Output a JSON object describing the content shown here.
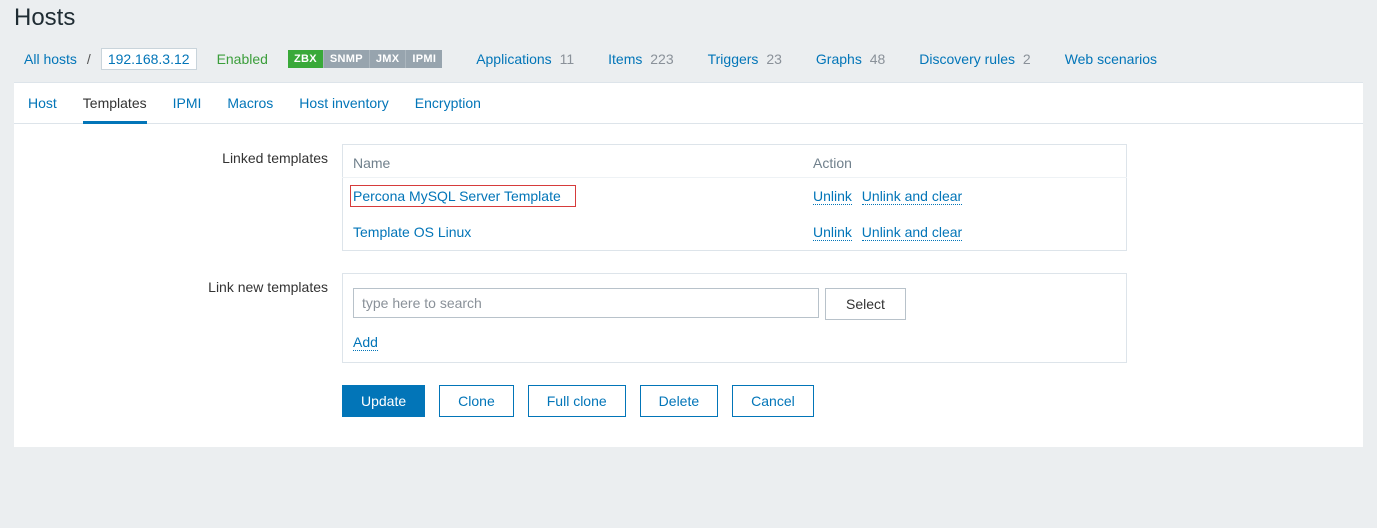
{
  "page": {
    "title": "Hosts"
  },
  "breadcrumb": {
    "all_hosts": "All hosts",
    "sep": "/",
    "host_ip": "192.168.3.12",
    "status": "Enabled",
    "protocols": [
      {
        "code": "ZBX",
        "kind": "zbx"
      },
      {
        "code": "SNMP",
        "kind": "gray"
      },
      {
        "code": "JMX",
        "kind": "gray"
      },
      {
        "code": "IPMI",
        "kind": "gray"
      }
    ],
    "nav": [
      {
        "label": "Applications",
        "count": "11"
      },
      {
        "label": "Items",
        "count": "223"
      },
      {
        "label": "Triggers",
        "count": "23"
      },
      {
        "label": "Graphs",
        "count": "48"
      },
      {
        "label": "Discovery rules",
        "count": "2"
      },
      {
        "label": "Web scenarios",
        "count": ""
      }
    ]
  },
  "tabs": [
    {
      "label": "Host",
      "active": false
    },
    {
      "label": "Templates",
      "active": true
    },
    {
      "label": "IPMI",
      "active": false
    },
    {
      "label": "Macros",
      "active": false
    },
    {
      "label": "Host inventory",
      "active": false
    },
    {
      "label": "Encryption",
      "active": false
    }
  ],
  "linked_templates": {
    "section_label": "Linked templates",
    "col_name": "Name",
    "col_action": "Action",
    "rows": [
      {
        "name": "Percona MySQL Server Template",
        "highlight": true,
        "unlink": "Unlink",
        "unlink_clear": "Unlink and clear"
      },
      {
        "name": "Template OS Linux",
        "highlight": false,
        "unlink": "Unlink",
        "unlink_clear": "Unlink and clear"
      }
    ]
  },
  "link_new": {
    "section_label": "Link new templates",
    "placeholder": "type here to search",
    "select_label": "Select",
    "add_label": "Add"
  },
  "buttons": {
    "update": "Update",
    "clone": "Clone",
    "full_clone": "Full clone",
    "delete": "Delete",
    "cancel": "Cancel"
  }
}
